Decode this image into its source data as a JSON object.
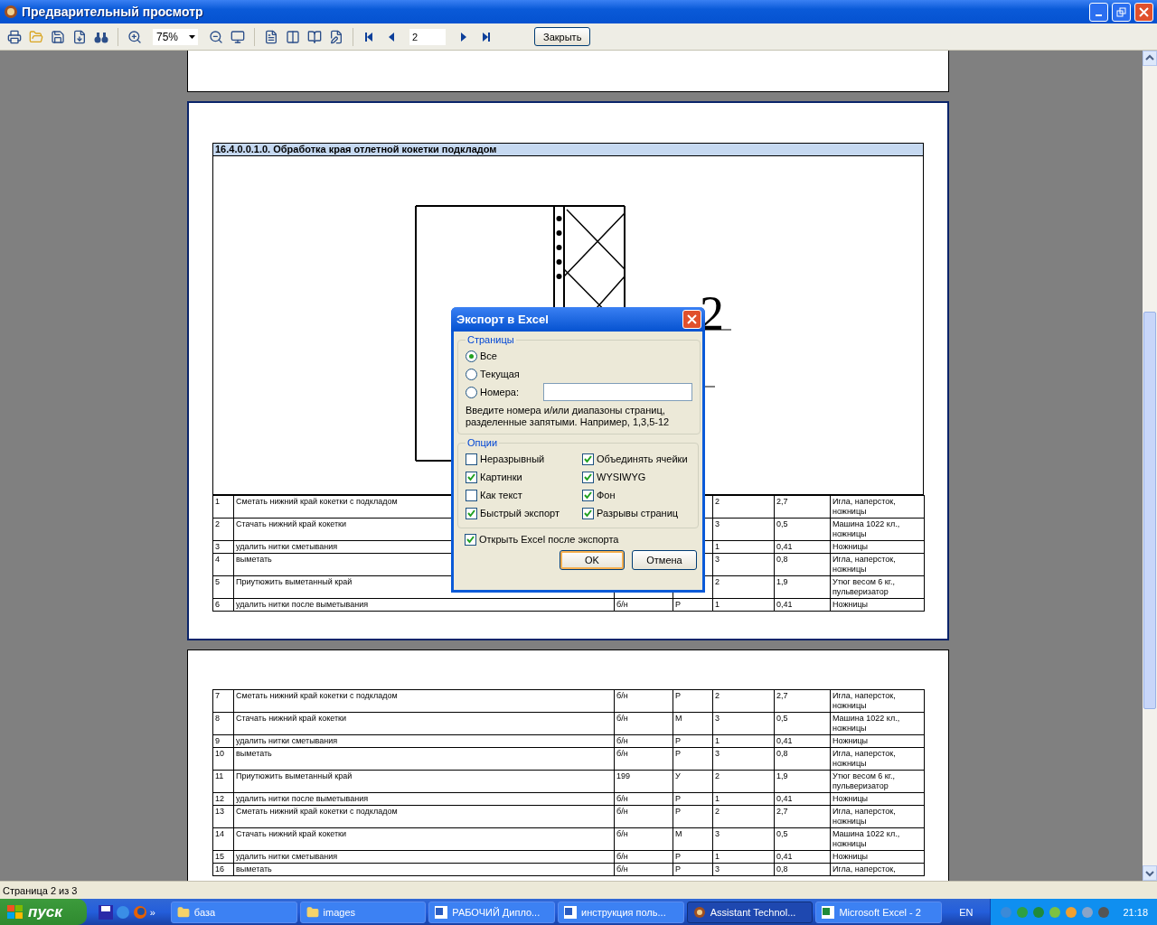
{
  "window": {
    "title": "Предварительный просмотр"
  },
  "toolbar": {
    "zoom": "75%",
    "page": "2",
    "close_button": "Закрыть"
  },
  "report": {
    "pages": [
      {
        "selected": false
      },
      {
        "selected": true,
        "section_title": "16.4.0.0.1.0. Обработка края отлетной кокетки подкладом",
        "drawing_label": "2",
        "rows": [
          {
            "cells": [
              "1",
              "Сметать нижний край кокетки с подкладом",
              null,
              null,
              "2",
              "2,7",
              "Игла, наперсток, ножницы"
            ]
          },
          {
            "cells": [
              "2",
              "Стачать нижний край кокетки",
              null,
              null,
              "3",
              "0,5",
              "Машина 1022 кл., ножницы"
            ]
          },
          {
            "cells": [
              "3",
              "удалить нитки сметывания",
              null,
              null,
              "1",
              "0,41",
              "Ножницы"
            ]
          },
          {
            "cells": [
              "4",
              "выметать",
              null,
              null,
              "3",
              "0,8",
              "Игла, наперсток, ножницы"
            ]
          },
          {
            "cells": [
              "5",
              "Приутюжить выметанный край",
              null,
              null,
              "2",
              "1,9",
              "Утюг весом 6 кг., пульверизатор"
            ]
          },
          {
            "cells": [
              "6",
              "удалить нитки после выметывания",
              "б/н",
              "Р",
              "1",
              "0,41",
              "Ножницы"
            ]
          }
        ]
      },
      {
        "selected": false,
        "rows": [
          {
            "cells": [
              "7",
              "Сметать нижний край кокетки с подкладом",
              "б/н",
              "Р",
              "2",
              "2,7",
              "Игла, наперсток, ножницы"
            ]
          },
          {
            "cells": [
              "8",
              "Стачать нижний край кокетки",
              "б/н",
              "М",
              "3",
              "0,5",
              "Машина 1022 кл., ножницы"
            ]
          },
          {
            "cells": [
              "9",
              "удалить нитки сметывания",
              "б/н",
              "Р",
              "1",
              "0,41",
              "Ножницы"
            ]
          },
          {
            "cells": [
              "10",
              "выметать",
              "б/н",
              "Р",
              "3",
              "0,8",
              "Игла, наперсток, ножницы"
            ]
          },
          {
            "cells": [
              "11",
              "Приутюжить выметанный край",
              "199",
              "У",
              "2",
              "1,9",
              "Утюг весом 6 кг., пульверизатор"
            ]
          },
          {
            "cells": [
              "12",
              "удалить нитки после выметывания",
              "б/н",
              "Р",
              "1",
              "0,41",
              "Ножницы"
            ]
          },
          {
            "cells": [
              "13",
              "Сметать нижний край кокетки с подкладом",
              "б/н",
              "Р",
              "2",
              "2,7",
              "Игла, наперсток, ножницы"
            ]
          },
          {
            "cells": [
              "14",
              "Стачать нижний край кокетки",
              "б/н",
              "М",
              "3",
              "0,5",
              "Машина 1022 кл., ножницы"
            ]
          },
          {
            "cells": [
              "15",
              "удалить нитки сметывания",
              "б/н",
              "Р",
              "1",
              "0,41",
              "Ножницы"
            ]
          },
          {
            "cells": [
              "16",
              "выметать",
              "б/н",
              "Р",
              "3",
              "0,8",
              "Игла, наперсток,"
            ]
          }
        ]
      }
    ]
  },
  "dialog": {
    "title": "Экспорт в Excel",
    "pages_group": "Страницы",
    "radios": [
      {
        "label": "Все",
        "selected": true
      },
      {
        "label": "Текущая",
        "selected": false
      },
      {
        "label": "Номера:",
        "selected": false
      }
    ],
    "hint": "Введите номера и/или диапазоны страниц, разделенные запятыми. Например, 1,3,5-12",
    "options_group": "Опции",
    "options": [
      {
        "label": "Неразрывный",
        "checked": false
      },
      {
        "label": "Объединять ячейки",
        "checked": true
      },
      {
        "label": "Картинки",
        "checked": true
      },
      {
        "label": "WYSIWYG",
        "checked": true
      },
      {
        "label": "Как текст",
        "checked": false
      },
      {
        "label": "Фон",
        "checked": true
      },
      {
        "label": "Быстрый экспорт",
        "checked": true
      },
      {
        "label": "Разрывы страниц",
        "checked": true
      }
    ],
    "open_after": {
      "label": "Открыть Excel после экспорта",
      "checked": true
    },
    "buttons": [
      "OK",
      "Отмена"
    ]
  },
  "status_bar": "Страница 2 из 3",
  "taskbar": {
    "start": "пуск",
    "more": "»",
    "tasks": [
      {
        "label": "база",
        "kind": "folder",
        "selected": false
      },
      {
        "label": "images",
        "kind": "folder",
        "selected": false
      },
      {
        "label": "РАБОЧИЙ  Дипло...",
        "kind": "word",
        "selected": false
      },
      {
        "label": "инструкция поль...",
        "kind": "word",
        "selected": false
      },
      {
        "label": "Assistant Technol...",
        "kind": "app",
        "selected": true
      },
      {
        "label": "Microsoft Excel - 2",
        "kind": "excel",
        "selected": false
      }
    ],
    "language": "EN",
    "clock": "21:18"
  }
}
